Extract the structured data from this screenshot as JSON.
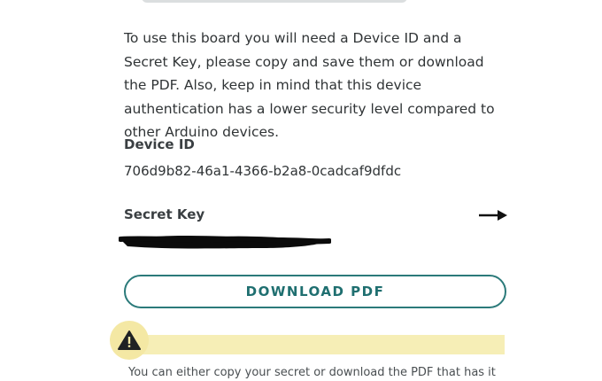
{
  "intro_text": "To use this board you will need a Device ID and a Secret Key, please copy and save them or download the PDF. Also, keep in mind that this device authentication has a lower security level compared to other Arduino devices.",
  "device_id": {
    "label": "Device ID",
    "value": "706d9b82-46a1-4366-b2a8-0cadcaf9dfdc"
  },
  "secret_key": {
    "label": "Secret Key",
    "arrow_icon": "arrow-right-icon",
    "value_icon": "redacted-scribble"
  },
  "download_button": {
    "label": "DOWNLOAD PDF"
  },
  "warning": {
    "icon": "warning-triangle-icon",
    "text": "You can either copy your secret or download the PDF that has it"
  },
  "colors": {
    "accent": "#2b7a7a",
    "warning_bg": "#f6eeb6",
    "warning_circle": "#f4e8a4"
  }
}
